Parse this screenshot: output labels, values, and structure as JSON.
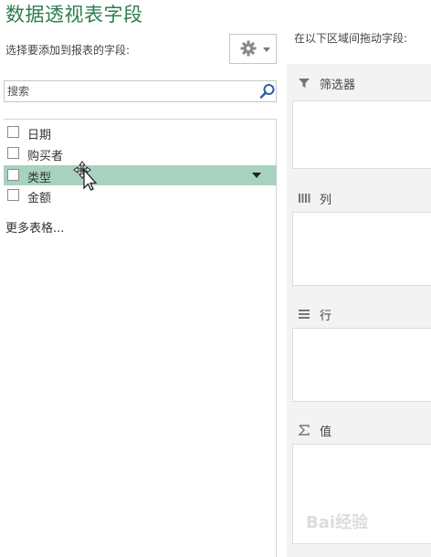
{
  "pane": {
    "title": "数据透视表字段",
    "choose_label": "选择要添加到报表的字段:",
    "right_hint": "在以下区域间拖动字段:",
    "search": {
      "placeholder": "搜索",
      "value": ""
    }
  },
  "fields": [
    {
      "label": "日期",
      "checked": false
    },
    {
      "label": "购买者",
      "checked": false
    },
    {
      "label": "类型",
      "checked": false,
      "highlighted": true
    },
    {
      "label": "金额",
      "checked": false
    }
  ],
  "more_tables": "更多表格...",
  "areas": [
    {
      "label": "筛选器",
      "icon": "filter-icon"
    },
    {
      "label": "列",
      "icon": "columns-icon"
    },
    {
      "label": "行",
      "icon": "rows-icon"
    },
    {
      "label": "值",
      "icon": "sigma-icon"
    }
  ],
  "watermark": "Bai经验",
  "colors": {
    "title_green": "#2e7d4f",
    "highlight": "#a7d2bf"
  },
  "icons": [
    "gear-icon",
    "chevron-down-icon",
    "search-icon",
    "move-cursor-icon",
    "filter-icon",
    "columns-icon",
    "rows-icon",
    "sigma-icon"
  ]
}
